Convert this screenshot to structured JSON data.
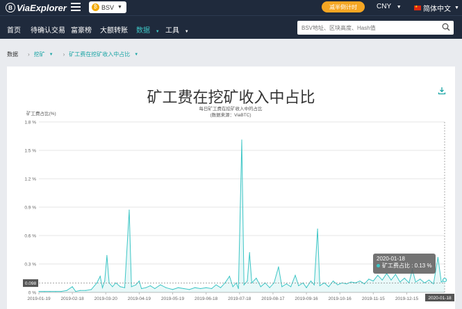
{
  "header": {
    "logo_text": "ViaExplorer",
    "coin": "BSV",
    "halving_label": "减半倒计时",
    "currency": "CNY",
    "language": "简体中文"
  },
  "nav": {
    "items": [
      "首页",
      "待确认交易",
      "富豪榜",
      "大额转账",
      "数据",
      "工具"
    ],
    "active": "数据",
    "search_placeholder": "BSV地址、区块高度、Hash值"
  },
  "breadcrumb": {
    "root": "数据",
    "level1": "挖矿",
    "level2": "矿工费在挖矿收入中占比"
  },
  "tooltip": {
    "date": "2020-01-18",
    "label": "矿工费占比 : 0.13 %"
  },
  "chart_data": {
    "type": "area",
    "title": "矿工费在挖矿收入中占比",
    "subtitle": "每日矿工费在挖矿收入中的占比",
    "source": "(数据来源：ViaBTC)",
    "ylabel": "矿工费占比(%)",
    "ylim": [
      0,
      1.8
    ],
    "yticks": [
      "0 %",
      "0.3 %",
      "0.6 %",
      "0.9 %",
      "1.2 %",
      "1.5 %",
      "1.8 %"
    ],
    "xticks": [
      "2019-01-19",
      "2019-02-18",
      "2019-03-20",
      "2019-04-19",
      "2019-05-19",
      "2019-06-18",
      "2019-07-18",
      "2019-08-17",
      "2019-09-16",
      "2019-10-16",
      "2019-11-15",
      "2019-12-15"
    ],
    "xlim": [
      "2019-01-19",
      "2020-01-18"
    ],
    "highlight_x": "2020-01-18",
    "highlight_y": 0.13,
    "y_marker_label": "0.098",
    "x_marker_label": "2020-01-18",
    "series": [
      {
        "name": "矿工费占比",
        "color": "#3ec6c6",
        "points": [
          [
            "2019-01-19",
            0.01
          ],
          [
            "2019-01-24",
            0.01
          ],
          [
            "2019-01-29",
            0.01
          ],
          [
            "2019-02-03",
            0.01
          ],
          [
            "2019-02-08",
            0.01
          ],
          [
            "2019-02-13",
            0.02
          ],
          [
            "2019-02-18",
            0.06
          ],
          [
            "2019-02-21",
            0.01
          ],
          [
            "2019-02-25",
            0.02
          ],
          [
            "2019-03-02",
            0.02
          ],
          [
            "2019-03-07",
            0.03
          ],
          [
            "2019-03-12",
            0.1
          ],
          [
            "2019-03-15",
            0.17
          ],
          [
            "2019-03-17",
            0.05
          ],
          [
            "2019-03-19",
            0.12
          ],
          [
            "2019-03-21",
            0.39
          ],
          [
            "2019-03-23",
            0.1
          ],
          [
            "2019-03-26",
            0.06
          ],
          [
            "2019-03-29",
            0.1
          ],
          [
            "2019-04-02",
            0.06
          ],
          [
            "2019-04-06",
            0.05
          ],
          [
            "2019-04-10",
            0.87
          ],
          [
            "2019-04-12",
            0.06
          ],
          [
            "2019-04-16",
            0.08
          ],
          [
            "2019-04-19",
            0.12
          ],
          [
            "2019-04-21",
            0.04
          ],
          [
            "2019-04-25",
            0.05
          ],
          [
            "2019-04-29",
            0.07
          ],
          [
            "2019-05-03",
            0.04
          ],
          [
            "2019-05-08",
            0.08
          ],
          [
            "2019-05-13",
            0.05
          ],
          [
            "2019-05-19",
            0.03
          ],
          [
            "2019-05-24",
            0.05
          ],
          [
            "2019-05-29",
            0.04
          ],
          [
            "2019-06-03",
            0.03
          ],
          [
            "2019-06-08",
            0.05
          ],
          [
            "2019-06-13",
            0.04
          ],
          [
            "2019-06-18",
            0.05
          ],
          [
            "2019-06-23",
            0.04
          ],
          [
            "2019-06-27",
            0.08
          ],
          [
            "2019-07-01",
            0.05
          ],
          [
            "2019-07-05",
            0.1
          ],
          [
            "2019-07-09",
            0.17
          ],
          [
            "2019-07-12",
            0.06
          ],
          [
            "2019-07-15",
            0.1
          ],
          [
            "2019-07-17",
            0.04
          ],
          [
            "2019-07-20",
            1.61
          ],
          [
            "2019-07-22",
            0.08
          ],
          [
            "2019-07-25",
            0.12
          ],
          [
            "2019-07-27",
            0.42
          ],
          [
            "2019-07-29",
            0.1
          ],
          [
            "2019-08-02",
            0.15
          ],
          [
            "2019-08-06",
            0.06
          ],
          [
            "2019-08-10",
            0.1
          ],
          [
            "2019-08-14",
            0.05
          ],
          [
            "2019-08-18",
            0.1
          ],
          [
            "2019-08-22",
            0.27
          ],
          [
            "2019-08-25",
            0.06
          ],
          [
            "2019-08-29",
            0.09
          ],
          [
            "2019-09-02",
            0.06
          ],
          [
            "2019-09-06",
            0.18
          ],
          [
            "2019-09-09",
            0.07
          ],
          [
            "2019-09-13",
            0.1
          ],
          [
            "2019-09-16",
            0.05
          ],
          [
            "2019-09-20",
            0.12
          ],
          [
            "2019-09-23",
            0.08
          ],
          [
            "2019-09-26",
            0.67
          ],
          [
            "2019-09-28",
            0.07
          ],
          [
            "2019-10-02",
            0.1
          ],
          [
            "2019-10-06",
            0.06
          ],
          [
            "2019-10-10",
            0.12
          ],
          [
            "2019-10-14",
            0.08
          ],
          [
            "2019-10-18",
            0.1
          ],
          [
            "2019-10-22",
            0.09
          ],
          [
            "2019-10-26",
            0.11
          ],
          [
            "2019-10-30",
            0.1
          ],
          [
            "2019-11-03",
            0.12
          ],
          [
            "2019-11-07",
            0.09
          ],
          [
            "2019-11-11",
            0.14
          ],
          [
            "2019-11-15",
            0.12
          ],
          [
            "2019-11-19",
            0.18
          ],
          [
            "2019-11-23",
            0.13
          ],
          [
            "2019-11-27",
            0.2
          ],
          [
            "2019-12-01",
            0.13
          ],
          [
            "2019-12-05",
            0.19
          ],
          [
            "2019-12-09",
            0.11
          ],
          [
            "2019-12-13",
            0.15
          ],
          [
            "2019-12-17",
            0.1
          ],
          [
            "2019-12-20",
            0.24
          ],
          [
            "2019-12-23",
            0.11
          ],
          [
            "2019-12-27",
            0.14
          ],
          [
            "2019-12-31",
            0.1
          ],
          [
            "2020-01-04",
            0.13
          ],
          [
            "2020-01-08",
            0.09
          ],
          [
            "2020-01-12",
            0.37
          ],
          [
            "2020-01-15",
            0.11
          ],
          [
            "2020-01-18",
            0.13
          ]
        ]
      }
    ]
  }
}
